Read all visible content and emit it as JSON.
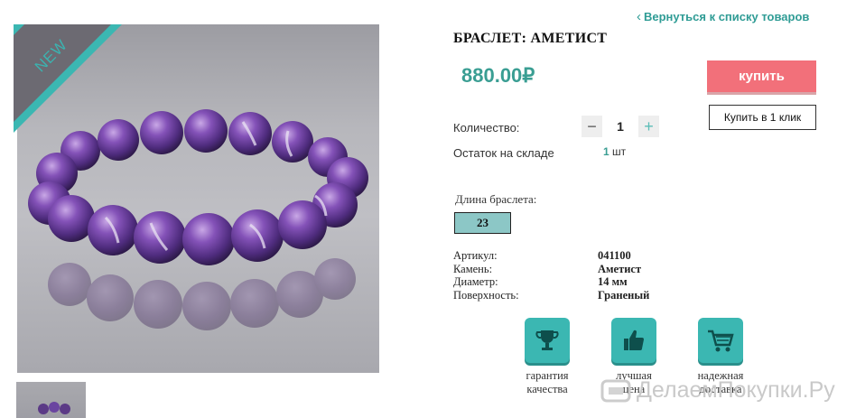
{
  "product": {
    "title": "БРАСЛЕТ: АМЕТИСТ",
    "price": "880.00₽",
    "badge": "NEW"
  },
  "nav": {
    "back_label": "Вернуться к списку товаров"
  },
  "actions": {
    "buy_label": "купить",
    "one_click_label": "Купить в 1 клик"
  },
  "quantity": {
    "label": "Количество:",
    "value": "1",
    "minus": "−",
    "plus": "+"
  },
  "stock": {
    "label": "Остаток на складе",
    "count": "1",
    "unit": "шт"
  },
  "length": {
    "label": "Длина браслета:",
    "selected": "23"
  },
  "specs": [
    {
      "key": "Артикул:",
      "value": "041100"
    },
    {
      "key": "Камень:",
      "value": "Аметист"
    },
    {
      "key": "Диаметр:",
      "value": "14 мм"
    },
    {
      "key": "Поверхность:",
      "value": "Граненый"
    }
  ],
  "features": [
    {
      "icon": "trophy-icon",
      "caption_line1": "гарантия",
      "caption_line2": "качества"
    },
    {
      "icon": "thumbs-up-icon",
      "caption_line1": "лучшая",
      "caption_line2": "цена"
    },
    {
      "icon": "cart-icon",
      "caption_line1": "надежная",
      "caption_line2": "доставка"
    }
  ],
  "watermark": {
    "text": "ДелаемПокупки.Ру"
  },
  "colors": {
    "accent": "#3bb7b2",
    "price": "#3a9e93",
    "buy": "#f2707a"
  }
}
